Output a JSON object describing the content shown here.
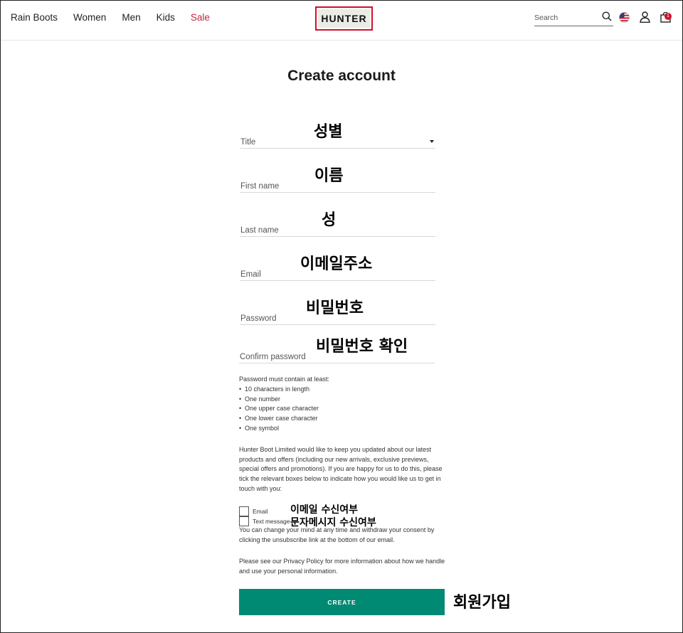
{
  "header": {
    "nav": [
      "Rain Boots",
      "Women",
      "Men",
      "Kids",
      "Sale"
    ],
    "logo": "HUNTER",
    "search_placeholder": "Search",
    "bag_count": "1"
  },
  "page_title": "Create account",
  "fields": [
    {
      "label": "Title",
      "annotation": "성별"
    },
    {
      "label": "First name",
      "annotation": "이름"
    },
    {
      "label": "Last name",
      "annotation": "성"
    },
    {
      "label": "Email",
      "annotation": "이메일주소"
    },
    {
      "label": "Password",
      "annotation": "비밀번호"
    },
    {
      "label": "Confirm password",
      "annotation": "비밀번호 확인"
    }
  ],
  "password_rules": {
    "intro": "Password must contain at least:",
    "items": [
      "10 characters in length",
      "One number",
      "One upper case character",
      "One lower case character",
      "One symbol"
    ]
  },
  "marketing_text": "Hunter Boot Limited would like to keep you updated about our latest products and offers (including our new arrivals, exclusive previews, special offers and promotions). If you are happy for us to do this, please tick the relevant boxes below to indicate how you would like us to get in touch with you:",
  "checkboxes": [
    {
      "label": "Email",
      "annotation": "이메일 수신여부"
    },
    {
      "label": "Text message",
      "annotation": "문자메시지 수신여부"
    }
  ],
  "consent_text": "You can change your mind at any time and withdraw your consent by clicking the unsubscribe link at the bottom of our email.",
  "privacy_text": "Please see our Privacy Policy for more information about how we handle and use your personal information.",
  "create_button": {
    "label": "CREATE",
    "annotation": "회원가입"
  },
  "colors": {
    "accent": "#008a73",
    "sale": "#c0273a",
    "logo_border": "#d0112b"
  }
}
